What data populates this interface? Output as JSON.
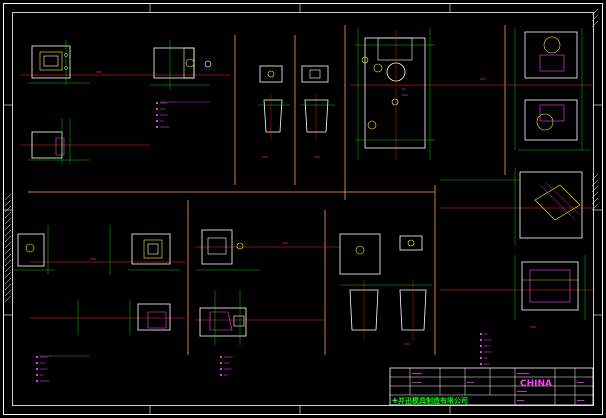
{
  "colors": {
    "background": "#000000",
    "border": "#ffffff",
    "part": "#ffffff",
    "centerline": "#ff2020",
    "dimension": "#00ff00",
    "text": "#ff40ff",
    "divider": "#ffa040",
    "hole": "#ffff00"
  },
  "title_block": {
    "country": "CHINA",
    "company": "并迅模具制造有限公司"
  }
}
